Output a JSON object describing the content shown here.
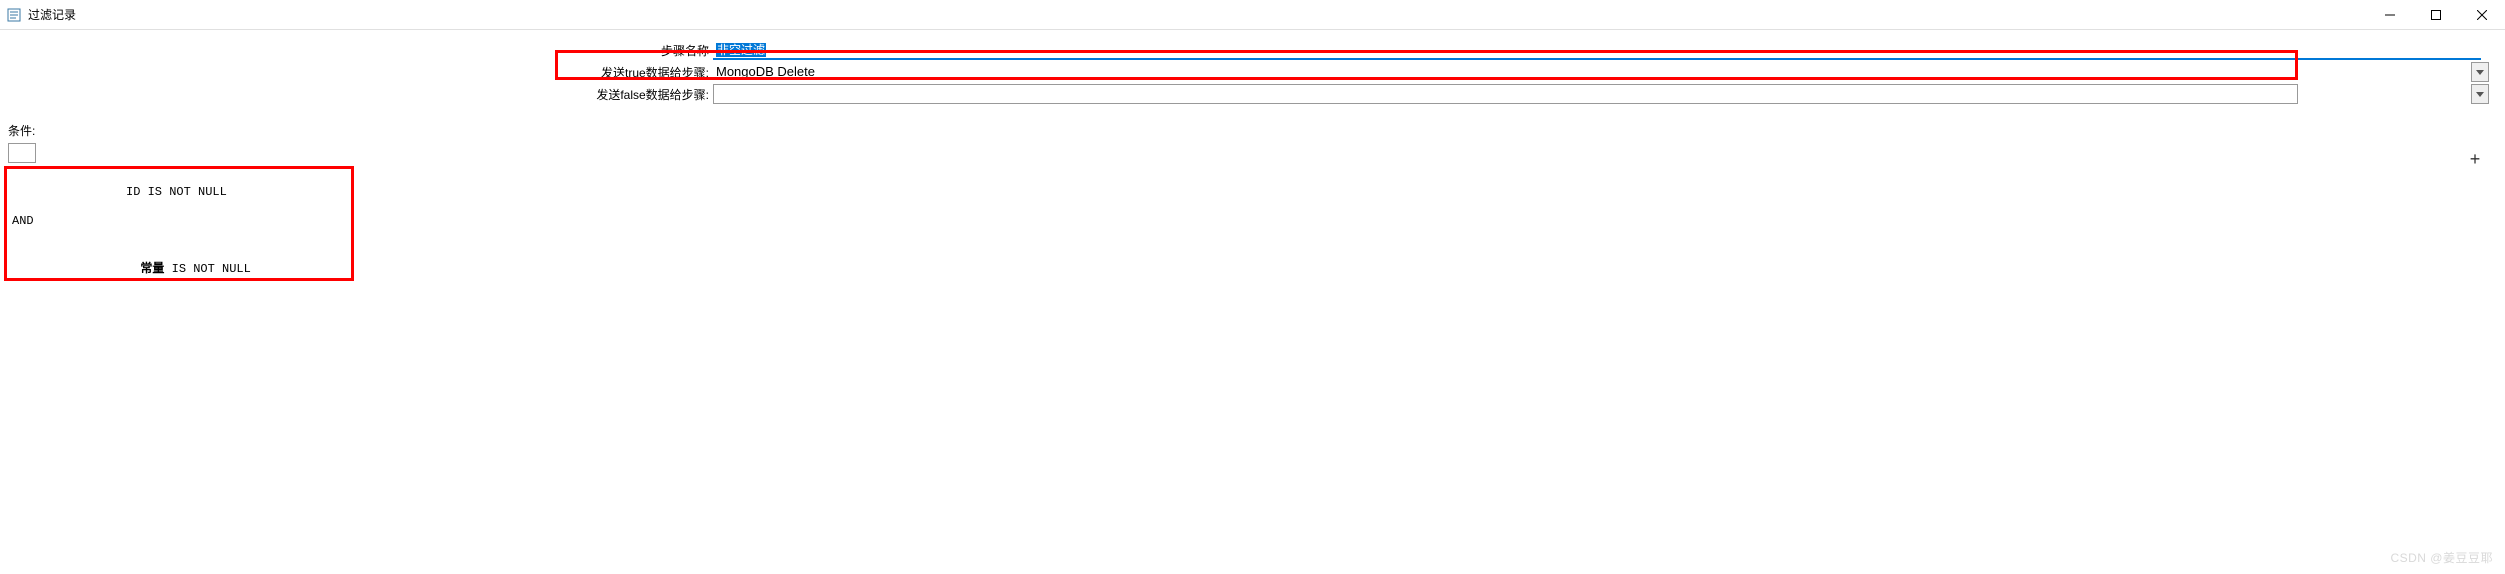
{
  "window": {
    "title": "过滤记录"
  },
  "form": {
    "step_name_label": "步骤名称",
    "step_name_value": "非空过滤",
    "true_step_label": "发送true数据给步骤:",
    "true_step_value": "MongoDB Delete",
    "false_step_label": "发送false数据给步骤:",
    "false_step_value": ""
  },
  "conditions": {
    "label": "条件:",
    "line1": "ID IS NOT NULL",
    "operator": "AND",
    "line2_field": "常量",
    "line2_rest": " IS NOT NULL"
  },
  "buttons": {
    "add": "+"
  },
  "watermark": "CSDN @姜豆豆耶"
}
